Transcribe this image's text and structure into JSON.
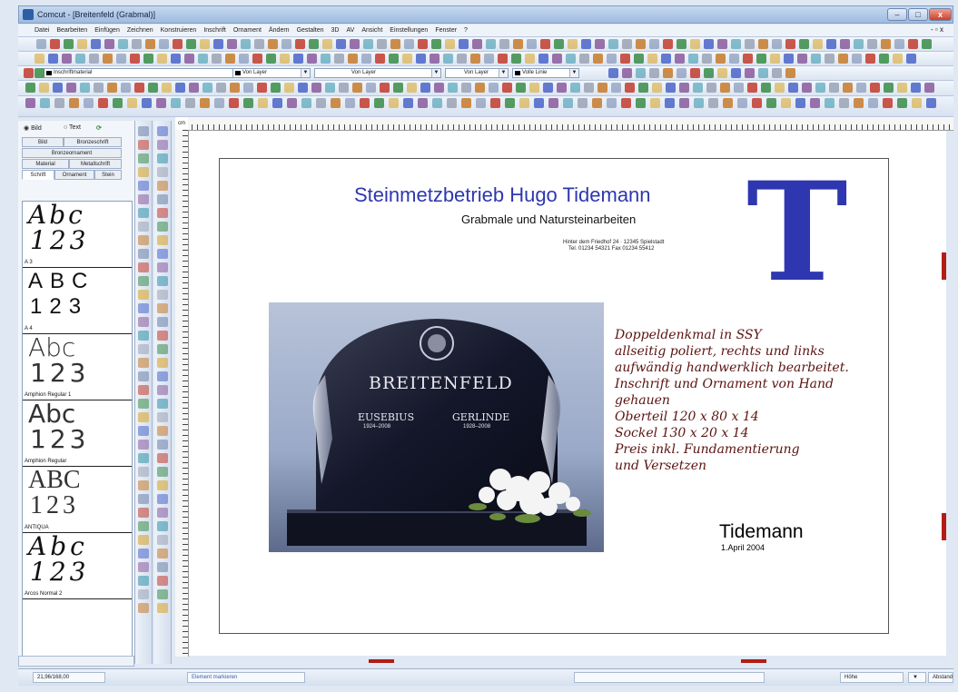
{
  "window": {
    "title": "Comcut - [Breitenfeld (Grabmal)]",
    "minimize": "–",
    "maximize": "□",
    "close": "x"
  },
  "menu": [
    "Datei",
    "Bearbeiten",
    "Einfügen",
    "Zeichnen",
    "Konstruieren",
    "Inschrift",
    "Ornament",
    "Ändern",
    "Gestalten",
    "3D",
    "AV",
    "Ansicht",
    "Einstellungen",
    "Fenster",
    "?"
  ],
  "toolbar": {
    "material_combo": "Inschriftmaterial",
    "layer_combo": "Von Layer",
    "linetype_combo": "Von Layer",
    "lineweight_combo": "Von Layer",
    "linestyle_combo": "Volle Linie"
  },
  "left_panel": {
    "radio_bild": "Bild",
    "radio_text": "Text",
    "tabs_row1": [
      "Bild",
      "Bronzeschrift"
    ],
    "tabs_row2": [
      "Bronzeornament"
    ],
    "tabs_row3": [
      "Material",
      "Metallschrift"
    ],
    "tabs_row4": [
      "Schrift",
      "Ornament",
      "Stein"
    ],
    "fonts": [
      {
        "line1": "Abc",
        "line2": "123",
        "name": "A 3"
      },
      {
        "line1": "ABC",
        "line2": "123",
        "name": "A 4"
      },
      {
        "line1": "Abc",
        "line2": "123",
        "name": "Amphion Regular 1"
      },
      {
        "line1": "Abc",
        "line2": "123",
        "name": "Amphion Regular"
      },
      {
        "line1": "ABC",
        "line2": "123",
        "name": "ANTIQUA"
      },
      {
        "line1": "Abc",
        "line2": "123",
        "name": "Arcos Normal 2"
      }
    ]
  },
  "ruler_corner": "cm",
  "document": {
    "company": "Steinmetzbetrieb Hugo Tidemann",
    "subtitle": "Grabmale und Natursteinarbeiten",
    "address1": "Hinter dem Friedhof 24 · 12345 Spielstadt",
    "address2": "Tel. 01234 54321 Fax 01234 55412",
    "logo_letter": "T",
    "stone_name": "BREITENFELD",
    "person1_name": "EUSEBIUS",
    "person1_years": "1924–2008",
    "person2_name": "GERLINDE",
    "person2_years": "1928–2008",
    "description": [
      "Doppeldenkmal in SSY",
      "allseitig poliert, rechts und links",
      "aufwändig handwerklich bearbeitet.",
      "Inschrift und Ornament von Hand",
      "gehauen",
      "Oberteil 120 x 80 x 14",
      "Sockel 130 x 20 x 14",
      "Preis inkl. Fundamentierung",
      "und Versetzen"
    ],
    "signature": "Tidemann",
    "date": "1.April 2004"
  },
  "status": {
    "coords": "21,96/168,00",
    "hint": "Element markieren",
    "height_label": "Höhe",
    "distance_label": "Abstand"
  }
}
